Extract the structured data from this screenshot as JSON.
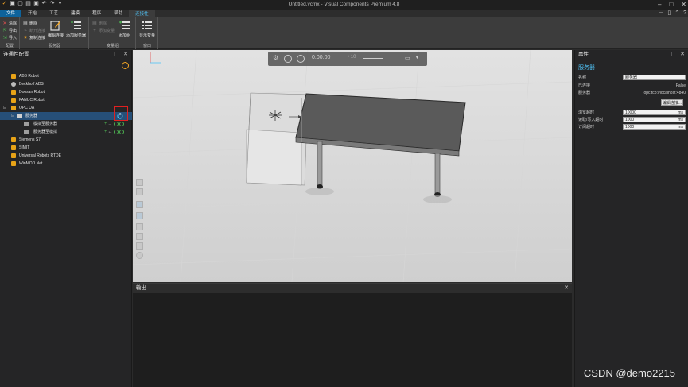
{
  "window": {
    "title": "Untitled.vcmx - Visual Components Premium 4.8",
    "controls": [
      "–",
      "□",
      "✕"
    ]
  },
  "ribbon_tabs": [
    "文件",
    "开始",
    "工艺",
    "建模",
    "程序",
    "帮助",
    "连接性"
  ],
  "active_tab": "连接性",
  "ribbon": {
    "config_group": {
      "label": "配置",
      "buttons": [
        {
          "label": "清除",
          "enabled": true
        },
        {
          "label": "导出",
          "enabled": true
        },
        {
          "label": "导入",
          "enabled": true
        }
      ]
    },
    "server_group": {
      "label": "服务器",
      "small_buttons": [
        {
          "label": "删除",
          "enabled": true
        },
        {
          "label": "断开连接",
          "enabled": false
        },
        {
          "label": "复制连接",
          "enabled": true
        }
      ],
      "big_buttons": [
        {
          "label": "编辑连接"
        },
        {
          "label": "添加服务器"
        }
      ]
    },
    "variables_group": {
      "label": "变量组",
      "small_buttons": [
        {
          "label": "删除",
          "enabled": false
        },
        {
          "label": "添加变量",
          "enabled": false
        }
      ],
      "big_buttons": [
        {
          "label": "添加组"
        }
      ]
    },
    "window_group": {
      "label": "窗口",
      "big_buttons": [
        {
          "label": "显示变量"
        }
      ]
    }
  },
  "left_panel": {
    "title": "连通性配置",
    "tree": [
      {
        "label": "ABB Robot",
        "level": 0,
        "selected": false
      },
      {
        "label": "Beckhoff ADS",
        "level": 0,
        "selected": false
      },
      {
        "label": "Doosan Robot",
        "level": 0,
        "selected": false
      },
      {
        "label": "FANUC Robot",
        "level": 0,
        "selected": false
      },
      {
        "label": "OPC UA",
        "level": 0,
        "selected": false,
        "expanded": true
      },
      {
        "label": "服务器",
        "level": 1,
        "selected": true,
        "expanded": true
      },
      {
        "label": "模拟至服务器",
        "level": 2,
        "selected": false
      },
      {
        "label": "服务器至模拟",
        "level": 2,
        "selected": false
      },
      {
        "label": "Siemens S7",
        "level": 0,
        "selected": false
      },
      {
        "label": "SIMIT",
        "level": 0,
        "selected": false
      },
      {
        "label": "Universal Robots RTDE",
        "level": 0,
        "selected": false
      },
      {
        "label": "WinMOD Net",
        "level": 0,
        "selected": false
      }
    ]
  },
  "sim_toolbar": {
    "time": "0:00:00",
    "speed": "• 10"
  },
  "output_panel": {
    "title": "输出"
  },
  "right_panel": {
    "title": "属性",
    "section_title": "服务器",
    "rows": [
      {
        "label": "名称",
        "value": "服务器",
        "editable": true,
        "unit": ""
      },
      {
        "label": "已连接",
        "value": "False",
        "editable": false,
        "unit": ""
      },
      {
        "label": "服务器",
        "value": "opc.tcp://localhost:4840",
        "editable": false,
        "unit": ""
      }
    ],
    "edit_button": "编辑连接...",
    "timeouts": [
      {
        "label": "浏览超时",
        "value": "10000",
        "unit": "ms"
      },
      {
        "label": "读取/写入超时",
        "value": "1000",
        "unit": "ms"
      },
      {
        "label": "订阅超时",
        "value": "1000",
        "unit": "ms"
      }
    ]
  },
  "watermark": "CSDN @demo2215",
  "colors": {
    "accent": "#4fc3f7",
    "file_tab": "#0e639c",
    "folder": "#e8a317",
    "selection": "#264f78",
    "highlight_box": "#e02020",
    "status_green": "#4caf50"
  }
}
